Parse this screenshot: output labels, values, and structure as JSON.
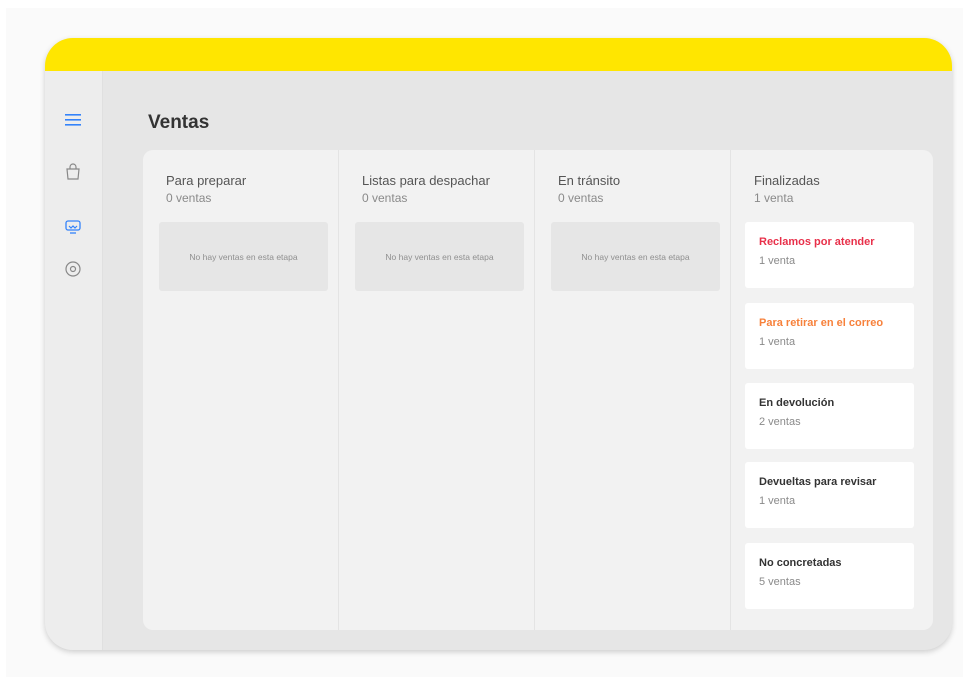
{
  "colors": {
    "brand_yellow": "#ffe600",
    "accent_blue": "#3483fa",
    "claim_red": "#e8304a",
    "mail_orange": "#f7813b",
    "neutral_dark": "#333333"
  },
  "sidebar": {
    "items": [
      {
        "icon": "menu-icon"
      },
      {
        "icon": "shopping-bag-icon"
      },
      {
        "icon": "sales-icon"
      },
      {
        "icon": "settings-icon"
      }
    ]
  },
  "page": {
    "title": "Ventas"
  },
  "columns": [
    {
      "title": "Para preparar",
      "count": "0 ventas",
      "empty_text": "No hay ventas en esta etapa"
    },
    {
      "title": "Listas para despachar",
      "count": "0 ventas",
      "empty_text": "No hay ventas en esta etapa"
    },
    {
      "title": "En tránsito",
      "count": "0 ventas",
      "empty_text": "No hay ventas en esta etapa"
    },
    {
      "title": "Finalizadas",
      "count": "1 venta",
      "cards": [
        {
          "title": "Reclamos por atender",
          "count": "1 venta",
          "color": "#e8304a"
        },
        {
          "title": "Para retirar en el correo",
          "count": "1 venta",
          "color": "#f7813b"
        },
        {
          "title": "En devolución",
          "count": "2 ventas",
          "color": "#333333"
        },
        {
          "title": "Devueltas para revisar",
          "count": "1 venta",
          "color": "#333333"
        },
        {
          "title": "No concretadas",
          "count": "5 ventas",
          "color": "#333333"
        }
      ]
    }
  ]
}
